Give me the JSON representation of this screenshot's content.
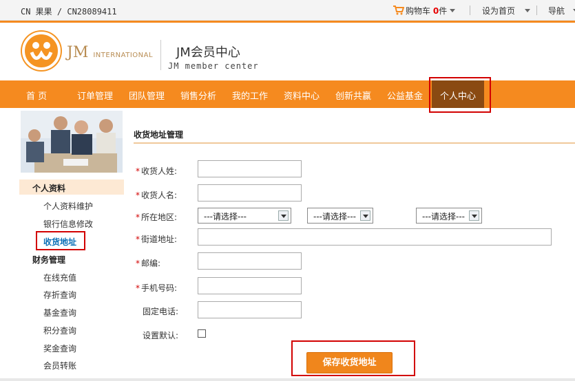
{
  "topbar": {
    "user": "CN 果果 / CN28089411",
    "cart_label": "购物车",
    "cart_count": "0",
    "cart_unit": "件",
    "set_home": "设为首页",
    "nav_label": "导航"
  },
  "header": {
    "logo_brand": "JM",
    "logo_sub": "INTERNATIONAL",
    "title": "JM会员中心",
    "subtitle": "JM member center"
  },
  "nav": {
    "items": [
      "首 页",
      "订单管理",
      "团队管理",
      "销售分析",
      "我的工作",
      "资料中心",
      "创新共赢",
      "公益基金",
      "个人中心"
    ]
  },
  "sidebar": {
    "section1": "个人资料",
    "links1": [
      "个人资料维护",
      "银行信息修改",
      "收货地址"
    ],
    "section2": "财务管理",
    "links2": [
      "在线充值",
      "存折查询",
      "基金查询",
      "积分查询",
      "奖金查询",
      "会员转账"
    ]
  },
  "form": {
    "title": "收货地址管理",
    "surname_label": "收货人姓:",
    "name_label": "收货人名:",
    "region_label": "所在地区:",
    "region_selects": [
      "---请选择---",
      "---请选择---",
      "---请选择---"
    ],
    "street_label": "街道地址:",
    "zip_label": "邮编:",
    "mobile_label": "手机号码:",
    "phone_label": "固定电话:",
    "default_label": "设置默认:",
    "save_label": "保存收货地址"
  },
  "colors": {
    "accent": "#f58a1f",
    "highlight": "#d20000",
    "active_nav": "#8a4a12"
  }
}
